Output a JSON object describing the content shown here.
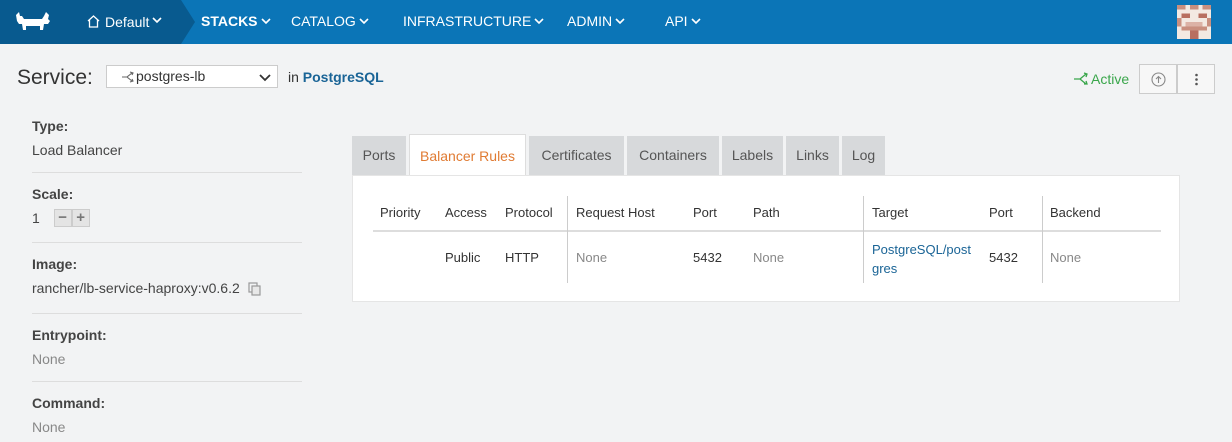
{
  "nav": {
    "environment": "Default",
    "items": [
      "STACKS",
      "CATALOG",
      "INFRASTRUCTURE",
      "ADMIN",
      "API"
    ]
  },
  "header": {
    "service_label": "Service:",
    "service_value": "postgres-lb",
    "in_prefix": "in",
    "stack_name": "PostgreSQL",
    "state": "Active"
  },
  "sidebar": {
    "type_label": "Type:",
    "type_value": "Load Balancer",
    "scale_label": "Scale:",
    "scale_value": "1",
    "scale_minus": "−",
    "scale_plus": "+",
    "image_label": "Image:",
    "image_value": "rancher/lb-service-haproxy:v0.6.2",
    "entrypoint_label": "Entrypoint:",
    "entrypoint_value": "None",
    "command_label": "Command:",
    "command_value": "None"
  },
  "tabs": [
    "Ports",
    "Balancer Rules",
    "Certificates",
    "Containers",
    "Labels",
    "Links",
    "Log"
  ],
  "rules_table": {
    "headers": [
      "Priority",
      "Access",
      "Protocol",
      "Request Host",
      "Port",
      "Path",
      "Target",
      "Port",
      "Backend"
    ],
    "row": {
      "priority": "",
      "access": "Public",
      "protocol": "HTTP",
      "request_host": "None",
      "port": "5432",
      "path": "None",
      "target": "PostgreSQL/postgres",
      "target_port": "5432",
      "backend": "None"
    }
  },
  "colors": {
    "nav_bg": "#0b75b7",
    "nav_dark": "#085a8f",
    "active_tab": "#e07b33",
    "state_green": "#3aa64b",
    "link": "#1a6496"
  }
}
